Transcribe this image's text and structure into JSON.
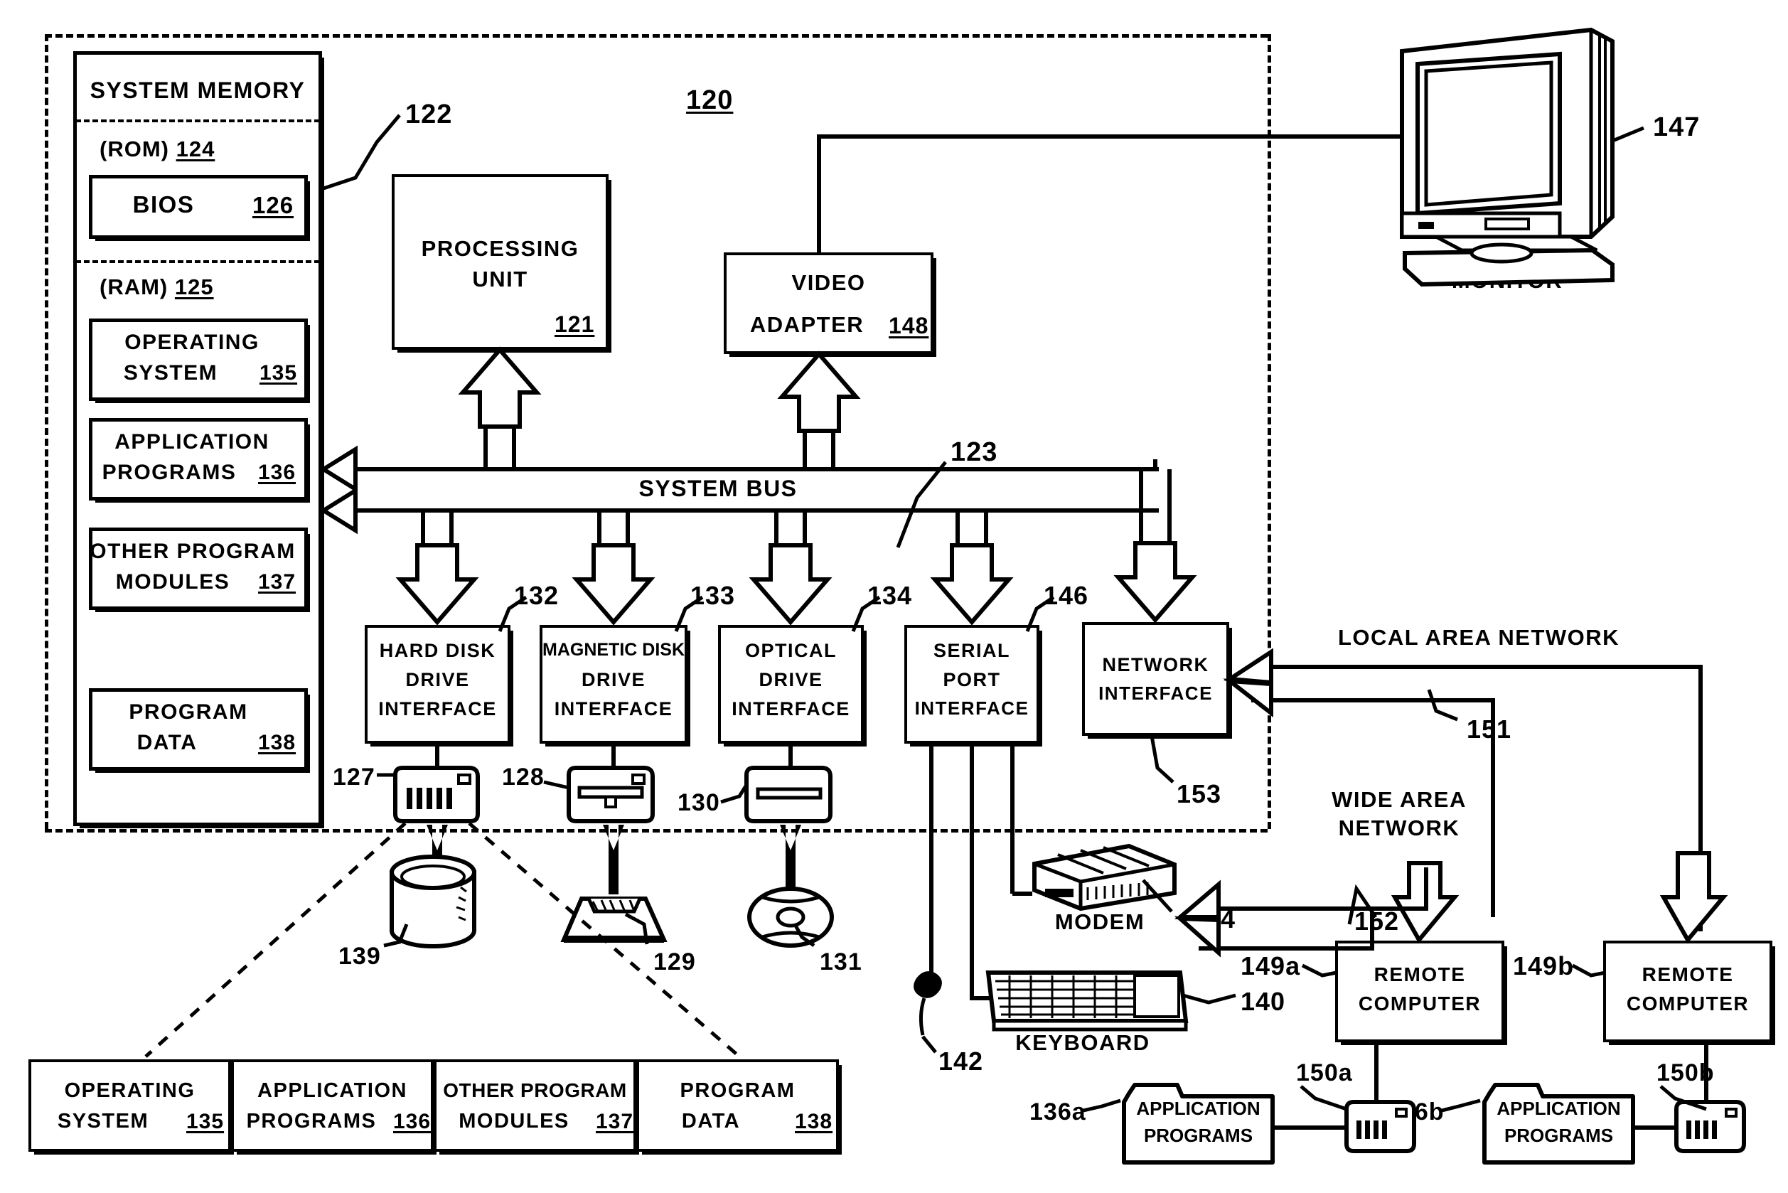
{
  "figure": {
    "outer_system_ref": "120",
    "system_memory_title": "SYSTEM MEMORY",
    "system_memory_ref": "122",
    "rom_label": "(ROM)",
    "rom_ref": "124",
    "ram_label": "(RAM)",
    "ram_ref": "125",
    "bios_label": "BIOS",
    "bios_ref": "126",
    "bus_label": "SYSTEM BUS",
    "bus_ref": "123"
  },
  "memory_cards": [
    {
      "name": "operating-system",
      "line1": "OPERATING",
      "line2": "SYSTEM",
      "ref": "135"
    },
    {
      "name": "application-programs",
      "line1": "APPLICATION",
      "line2": "PROGRAMS",
      "ref": "136"
    },
    {
      "name": "other-program-modules",
      "line1": "OTHER PROGRAM",
      "line2": "MODULES",
      "ref": "137"
    },
    {
      "name": "program-data",
      "line1": "PROGRAM",
      "line2": "DATA",
      "ref": "138"
    }
  ],
  "core_blocks": {
    "processing_unit": {
      "line1": "PROCESSING",
      "line2": "UNIT",
      "ref": "121"
    },
    "video_adapter": {
      "line1": "VIDEO",
      "line2": "ADAPTER",
      "ref": "148"
    }
  },
  "interfaces": [
    {
      "name": "hard-disk-drive-interface",
      "line1": "HARD DISK",
      "line2": "DRIVE",
      "line3": "INTERFACE",
      "ref": "132"
    },
    {
      "name": "magnetic-disk-drive-interface",
      "line1": "MAGNETIC DISK",
      "line2": "DRIVE",
      "line3": "INTERFACE",
      "ref": "133"
    },
    {
      "name": "optical-drive-interface",
      "line1": "OPTICAL",
      "line2": "DRIVE",
      "line3": "INTERFACE",
      "ref": "134"
    },
    {
      "name": "serial-port-interface",
      "line1": "SERIAL",
      "line2": "PORT",
      "line3": "INTERFACE",
      "ref": "146"
    },
    {
      "name": "network-interface",
      "line1": "NETWORK",
      "line2": "INTERFACE",
      "line3": "",
      "ref": "153"
    }
  ],
  "drives": [
    {
      "name": "hard-disk-drive",
      "ref": "127",
      "media_ref": "139"
    },
    {
      "name": "magnetic-disk-drive",
      "ref": "128",
      "media_ref": "129"
    },
    {
      "name": "optical-drive",
      "ref": "130",
      "media_ref": "131"
    }
  ],
  "peripherals": {
    "monitor_label": "MONITOR",
    "monitor_ref": "147",
    "keyboard_label": "KEYBOARD",
    "keyboard_ref": "140",
    "mouse_ref": "142",
    "modem_label": "MODEM",
    "modem_ref": "154"
  },
  "networks": {
    "lan_label": "LOCAL AREA NETWORK",
    "lan_ref": "151",
    "wan_label_line1": "WIDE AREA",
    "wan_label_line2": "NETWORK",
    "wan_ref": "152"
  },
  "remote": [
    {
      "name": "remote-computer-a",
      "line1": "REMOTE",
      "line2": "COMPUTER",
      "ref": "149a",
      "apps_line1": "APPLICATION",
      "apps_line2": "PROGRAMS",
      "apps_ref": "136a",
      "storage_ref": "150a"
    },
    {
      "name": "remote-computer-b",
      "line1": "REMOTE",
      "line2": "COMPUTER",
      "ref": "149b",
      "apps_line1": "APPLICATION",
      "apps_line2": "PROGRAMS",
      "apps_ref": "136b",
      "storage_ref": "150b"
    }
  ],
  "bottom_strip": [
    {
      "name": "operating-system",
      "line1": "OPERATING",
      "line2": "SYSTEM",
      "ref": "135"
    },
    {
      "name": "application-programs",
      "line1": "APPLICATION",
      "line2": "PROGRAMS",
      "ref": "136"
    },
    {
      "name": "other-program-modules",
      "line1": "OTHER PROGRAM",
      "line2": "MODULES",
      "ref": "137"
    },
    {
      "name": "program-data",
      "line1": "PROGRAM",
      "line2": "DATA",
      "ref": "138"
    }
  ],
  "colors": {
    "ink": "#000000",
    "paper": "#ffffff"
  }
}
